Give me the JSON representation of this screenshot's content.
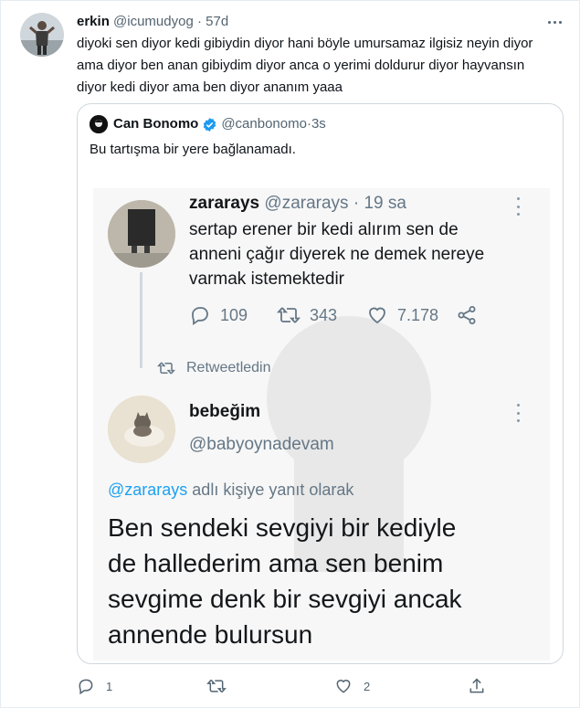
{
  "tweet": {
    "author_name": "erkin",
    "author_handle": "@icumudyog",
    "separator": "·",
    "time": "57d",
    "text_lines": [
      "diyoki sen diyor kedi gibiydin diyor hani böyle umursamaz ilgisiz neyin diyor",
      "ama diyor ben anan gibiydim diyor anca o yerimi doldurur diyor hayvansın",
      "diyor kedi diyor ama ben diyor ananım yaaa"
    ],
    "stats": {
      "replies": "1",
      "retweets": "",
      "likes": "2"
    }
  },
  "quote": {
    "author_name": "Can Bonomo",
    "author_handle": "@canbonomo",
    "separator": "·",
    "time": "3s",
    "text": "Bu tartışma bir yere bağlanamadı.",
    "embedded": {
      "first": {
        "name": "zararays",
        "handle": "@zararays",
        "separator": "·",
        "time": "19 sa",
        "text_lines": [
          "sertap erener bir kedi alırım sen de",
          "anneni çağır diyerek ne demek nereye",
          "varmak istemektedir"
        ],
        "replies": "109",
        "retweets": "343",
        "likes": "7.178"
      },
      "retweet_label": "Retweetledin",
      "second": {
        "name": "bebeğim",
        "handle": "@babyoynadevam",
        "reply_mention": "@zararays",
        "reply_suffix": " adlı kişiye yanıt olarak",
        "text_lines": [
          "Ben sendeki sevgiyi bir kediyle",
          "de hallederim ama sen benim",
          "sevgime denk bir sevgiyi ancak",
          "annende bulursun"
        ]
      }
    }
  },
  "colors": {
    "link": "#1da1f2",
    "verified": "#1d9bf0",
    "muted": "#536471"
  },
  "icons": [
    "more-icon",
    "verified-icon",
    "reply-icon",
    "retweet-icon",
    "like-icon",
    "share-icon"
  ]
}
